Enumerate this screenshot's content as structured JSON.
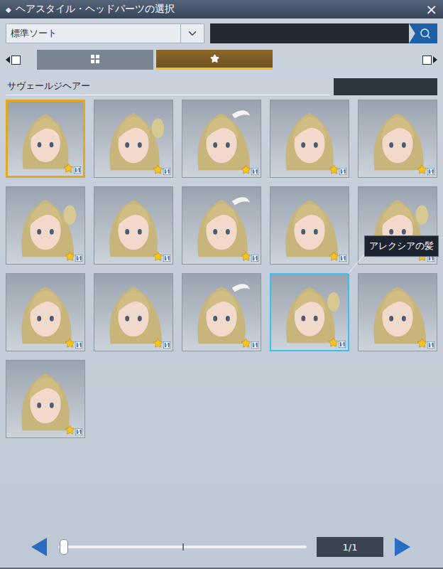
{
  "window": {
    "icon": "◆",
    "title": "ヘアスタイル・ヘッドパーツの選択",
    "close": "×"
  },
  "sort": {
    "label": "標準ソート"
  },
  "search": {
    "placeholder": ""
  },
  "tabs": [
    {
      "kind": "grid",
      "selected": false
    },
    {
      "kind": "favorites",
      "selected": true
    }
  ],
  "category": {
    "label": "サヴェールジヘアー"
  },
  "items": [
    {
      "selected": true,
      "hovered": false,
      "favorite": true
    },
    {
      "selected": false,
      "hovered": false,
      "favorite": true
    },
    {
      "selected": false,
      "hovered": false,
      "favorite": true
    },
    {
      "selected": false,
      "hovered": false,
      "favorite": true
    },
    {
      "selected": false,
      "hovered": false,
      "favorite": true
    },
    {
      "selected": false,
      "hovered": false,
      "favorite": true
    },
    {
      "selected": false,
      "hovered": false,
      "favorite": true
    },
    {
      "selected": false,
      "hovered": false,
      "favorite": true
    },
    {
      "selected": false,
      "hovered": false,
      "favorite": true
    },
    {
      "selected": false,
      "hovered": false,
      "favorite": true
    },
    {
      "selected": false,
      "hovered": false,
      "favorite": true
    },
    {
      "selected": false,
      "hovered": false,
      "favorite": true
    },
    {
      "selected": false,
      "hovered": false,
      "favorite": true
    },
    {
      "selected": false,
      "hovered": true,
      "favorite": true
    },
    {
      "selected": false,
      "hovered": false,
      "favorite": true
    },
    {
      "selected": false,
      "hovered": false,
      "favorite": true
    }
  ],
  "tooltip": {
    "text": "アレクシアの髪"
  },
  "pagination": {
    "page": "1/1",
    "level": 0
  }
}
